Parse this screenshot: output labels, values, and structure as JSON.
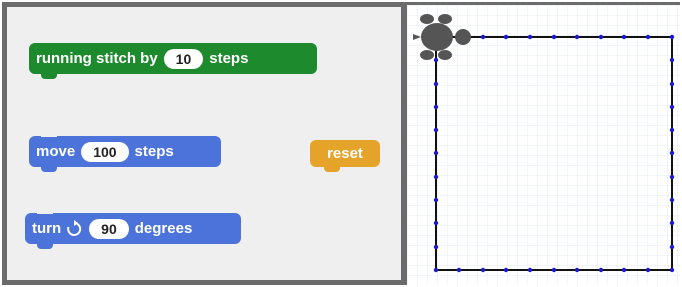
{
  "script_area": {
    "running_stitch_block": {
      "prefix": "running stitch by",
      "value": "10",
      "suffix": "steps",
      "color": "#1e8a2e"
    },
    "move_block": {
      "prefix": "move",
      "value": "100",
      "suffix": "steps",
      "color": "#4c73d9"
    },
    "turn_block": {
      "prefix": "turn",
      "icon": "rotate-clockwise-icon",
      "value": "90",
      "suffix": "degrees",
      "color": "#4c73d9"
    },
    "reset_block": {
      "label": "reset",
      "color": "#e6a32a"
    }
  },
  "stage": {
    "sprite": "turtle-icon",
    "drawing": {
      "shape": "square",
      "stitch_color": "#1a1acc",
      "line_color": "#111111"
    },
    "grid": true
  }
}
